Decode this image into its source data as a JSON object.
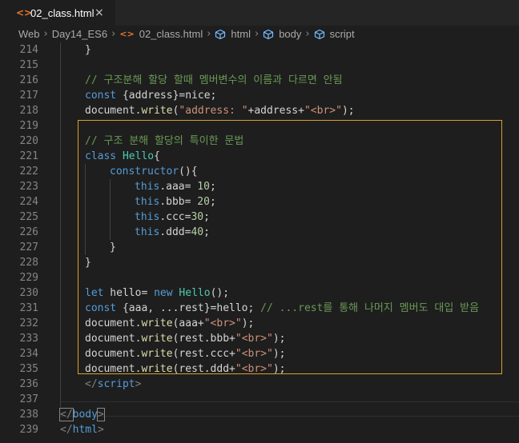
{
  "tab": {
    "icon": "<>",
    "filename": "02_class.html",
    "close": "×"
  },
  "breadcrumb": {
    "items": [
      "Web",
      "Day14_ES6",
      "02_class.html",
      "html",
      "body",
      "script"
    ],
    "separator": "›"
  },
  "colors": {
    "keyword": "#569cd6",
    "comment": "#6a9955",
    "string": "#ce9178",
    "number": "#b5cea8",
    "function": "#dcdcaa",
    "class": "#4ec9b0",
    "tag": "#808080",
    "highlight_box": "#d7a22a",
    "line_number": "#858585"
  },
  "lines": [
    {
      "n": "214",
      "indent": 1,
      "tokens": [
        [
          "p",
          "}"
        ]
      ]
    },
    {
      "n": "215",
      "indent": 0,
      "tokens": []
    },
    {
      "n": "216",
      "indent": 1,
      "tokens": [
        [
          "c",
          "// 구조분해 할당 할때 멤버변수의 이름과 다르면 안됨"
        ]
      ]
    },
    {
      "n": "217",
      "indent": 1,
      "tokens": [
        [
          "k",
          "const"
        ],
        [
          "p",
          " {address}=nice;"
        ]
      ]
    },
    {
      "n": "218",
      "indent": 1,
      "tokens": [
        [
          "p",
          "document."
        ],
        [
          "f",
          "write"
        ],
        [
          "p",
          "("
        ],
        [
          "s",
          "\"address: \""
        ],
        [
          "p",
          "+address+"
        ],
        [
          "s",
          "\"<br>\""
        ],
        [
          "p",
          ");"
        ]
      ]
    },
    {
      "n": "219",
      "indent": 0,
      "tokens": []
    },
    {
      "n": "220",
      "indent": 1,
      "tokens": [
        [
          "c",
          "// 구조 분해 할당의 특이한 문법"
        ]
      ]
    },
    {
      "n": "221",
      "indent": 1,
      "tokens": [
        [
          "k",
          "class"
        ],
        [
          "p",
          " "
        ],
        [
          "cl",
          "Hello"
        ],
        [
          "p",
          "{"
        ]
      ]
    },
    {
      "n": "222",
      "indent": 2,
      "tokens": [
        [
          "k",
          "constructor"
        ],
        [
          "p",
          "(){"
        ]
      ]
    },
    {
      "n": "223",
      "indent": 3,
      "tokens": [
        [
          "k",
          "this"
        ],
        [
          "p",
          ".aaa= "
        ],
        [
          "n",
          "10"
        ],
        [
          "p",
          ";"
        ]
      ]
    },
    {
      "n": "224",
      "indent": 3,
      "tokens": [
        [
          "k",
          "this"
        ],
        [
          "p",
          ".bbb= "
        ],
        [
          "n",
          "20"
        ],
        [
          "p",
          ";"
        ]
      ]
    },
    {
      "n": "225",
      "indent": 3,
      "tokens": [
        [
          "k",
          "this"
        ],
        [
          "p",
          ".ccc="
        ],
        [
          "n",
          "30"
        ],
        [
          "p",
          ";"
        ]
      ]
    },
    {
      "n": "226",
      "indent": 3,
      "tokens": [
        [
          "k",
          "this"
        ],
        [
          "p",
          ".ddd="
        ],
        [
          "n",
          "40"
        ],
        [
          "p",
          ";"
        ]
      ]
    },
    {
      "n": "227",
      "indent": 2,
      "tokens": [
        [
          "p",
          "}"
        ]
      ]
    },
    {
      "n": "228",
      "indent": 1,
      "tokens": [
        [
          "p",
          "}"
        ]
      ]
    },
    {
      "n": "229",
      "indent": 0,
      "tokens": []
    },
    {
      "n": "230",
      "indent": 1,
      "tokens": [
        [
          "k",
          "let"
        ],
        [
          "p",
          " hello= "
        ],
        [
          "k",
          "new"
        ],
        [
          "p",
          " "
        ],
        [
          "cl",
          "Hello"
        ],
        [
          "p",
          "();"
        ]
      ]
    },
    {
      "n": "231",
      "indent": 1,
      "tokens": [
        [
          "k",
          "const"
        ],
        [
          "p",
          " {aaa, ...rest}=hello; "
        ],
        [
          "c",
          "// ...rest를 통해 나머지 멤버도 대입 받음"
        ]
      ]
    },
    {
      "n": "232",
      "indent": 1,
      "tokens": [
        [
          "p",
          "document."
        ],
        [
          "f",
          "write"
        ],
        [
          "p",
          "(aaa+"
        ],
        [
          "s",
          "\"<br>\""
        ],
        [
          "p",
          ");"
        ]
      ]
    },
    {
      "n": "233",
      "indent": 1,
      "tokens": [
        [
          "p",
          "document."
        ],
        [
          "f",
          "write"
        ],
        [
          "p",
          "(rest.bbb+"
        ],
        [
          "s",
          "\"<br>\""
        ],
        [
          "p",
          ");"
        ]
      ]
    },
    {
      "n": "234",
      "indent": 1,
      "tokens": [
        [
          "p",
          "document."
        ],
        [
          "f",
          "write"
        ],
        [
          "p",
          "(rest.ccc+"
        ],
        [
          "s",
          "\"<br>\""
        ],
        [
          "p",
          ");"
        ]
      ]
    },
    {
      "n": "235",
      "indent": 1,
      "tokens": [
        [
          "p",
          "document."
        ],
        [
          "f",
          "write"
        ],
        [
          "p",
          "(rest.ddd+"
        ],
        [
          "s",
          "\"<br>\""
        ],
        [
          "p",
          ");"
        ]
      ]
    },
    {
      "n": "236",
      "indent": 1,
      "tokens": [
        [
          "t",
          "</"
        ],
        [
          "k",
          "script"
        ],
        [
          "t",
          ">"
        ]
      ]
    },
    {
      "n": "237",
      "indent": 0,
      "tokens": []
    },
    {
      "n": "238",
      "indent": 0,
      "tokens": [
        [
          "tb",
          "</"
        ],
        [
          "k",
          "body"
        ],
        [
          "tb",
          ">"
        ]
      ]
    },
    {
      "n": "239",
      "indent": 0,
      "tokens": [
        [
          "t",
          "</"
        ],
        [
          "k",
          "html"
        ],
        [
          "t",
          ">"
        ]
      ]
    }
  ]
}
